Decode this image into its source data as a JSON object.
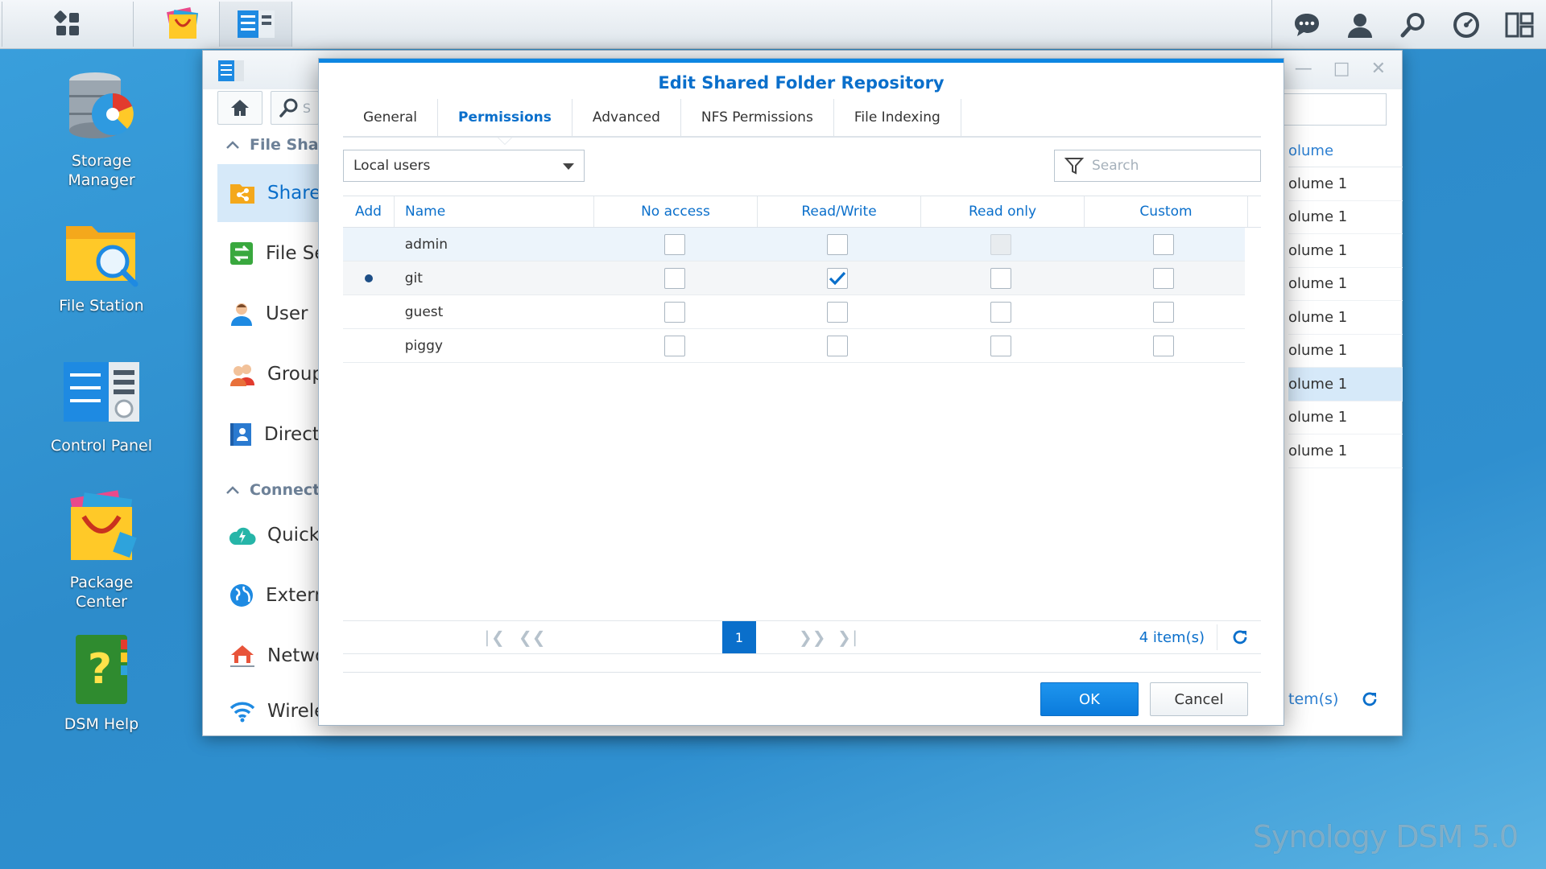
{
  "desktop": {
    "icons": [
      {
        "label": "Storage\nManager"
      },
      {
        "label": "File Station"
      },
      {
        "label": "Control Panel"
      },
      {
        "label": "Package\nCenter"
      },
      {
        "label": "DSM Help"
      }
    ],
    "watermark": "Synology DSM 5.0"
  },
  "control_panel": {
    "search_placeholder": "S",
    "sections": [
      "File Shar",
      "Connect"
    ],
    "items": [
      "Shared",
      "File Se",
      "User",
      "Group",
      "Directo",
      "QuickC",
      "Extern",
      "Networ",
      "Wireless"
    ],
    "list_header": "olume",
    "list_rows": [
      "olume 1",
      "olume 1",
      "olume 1",
      "olume 1",
      "olume 1",
      "olume 1",
      "olume 1",
      "olume 1",
      "olume 1"
    ],
    "footer_count": "tem(s)"
  },
  "modal": {
    "title": "Edit Shared Folder Repository",
    "tabs": [
      "General",
      "Permissions",
      "Advanced",
      "NFS Permissions",
      "File Indexing"
    ],
    "active_tab": "Permissions",
    "user_filter": "Local users",
    "search_placeholder": "Search",
    "columns": {
      "add": "Add",
      "name": "Name",
      "no_access": "No access",
      "read_write": "Read/Write",
      "read_only": "Read only",
      "custom": "Custom"
    },
    "rows": [
      {
        "name": "admin",
        "added": false,
        "no_access": false,
        "read_write": false,
        "read_only": false,
        "read_only_disabled": true,
        "custom": false
      },
      {
        "name": "git",
        "added": true,
        "no_access": false,
        "read_write": true,
        "read_only": false,
        "read_only_disabled": false,
        "custom": false
      },
      {
        "name": "guest",
        "added": false,
        "no_access": false,
        "read_write": false,
        "read_only": false,
        "read_only_disabled": false,
        "custom": false
      },
      {
        "name": "piggy",
        "added": false,
        "no_access": false,
        "read_write": false,
        "read_only": false,
        "read_only_disabled": false,
        "custom": false
      }
    ],
    "pager": {
      "current_page": "1",
      "count": "4 item(s)"
    },
    "ok_label": "OK",
    "cancel_label": "Cancel"
  },
  "colors": {
    "accent": "#0a6fcb",
    "ok_button": "#0b7bdc",
    "desktop": "#2d8ccb",
    "selection": "#d6e9f9"
  }
}
